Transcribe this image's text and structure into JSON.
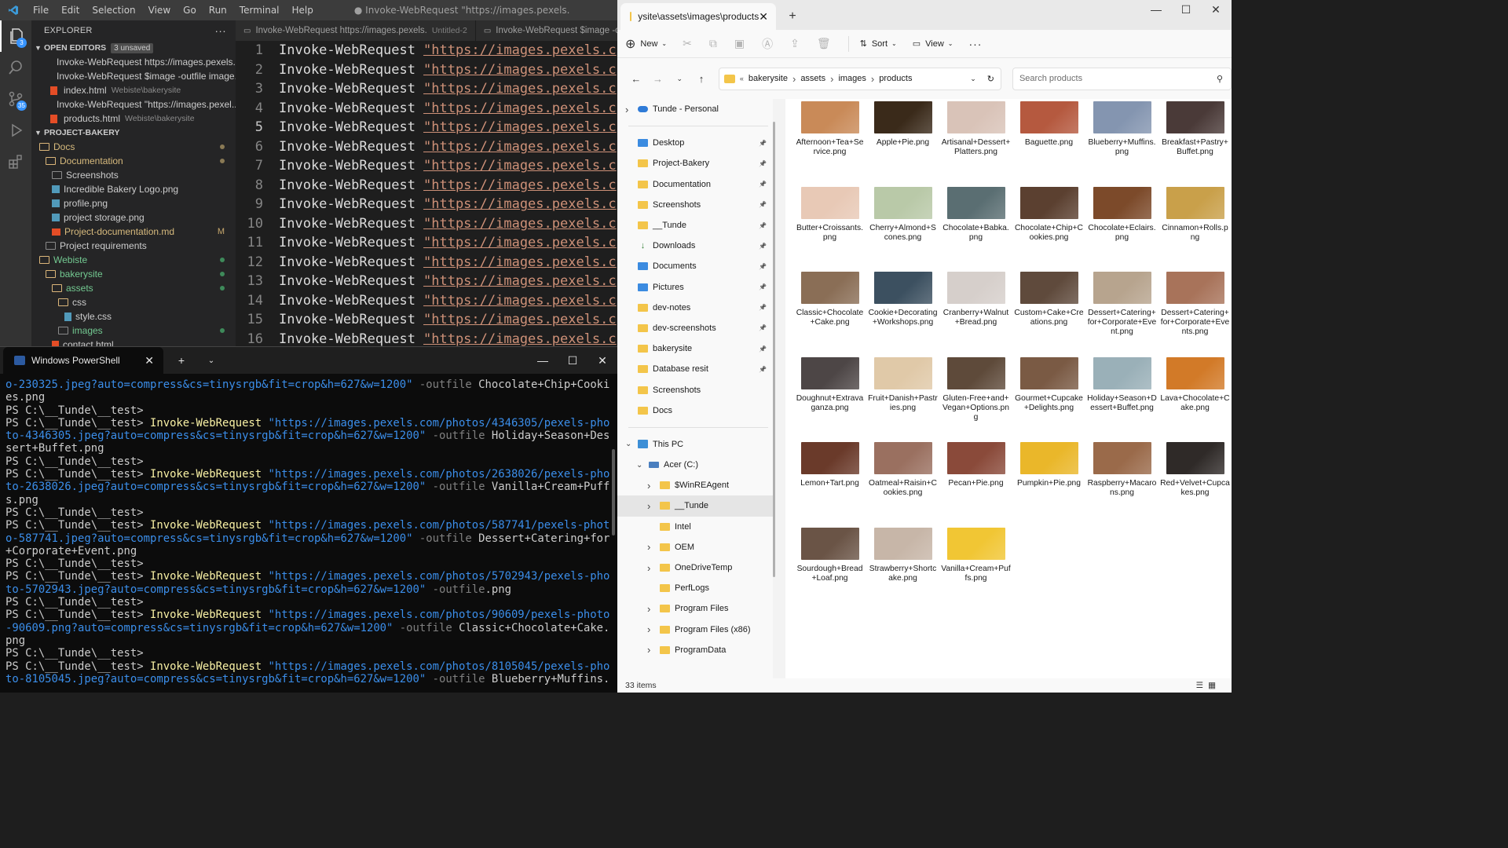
{
  "vscode": {
    "menus": [
      "File",
      "Edit",
      "Selection",
      "View",
      "Go",
      "Run",
      "Terminal",
      "Help"
    ],
    "window_title": "● Invoke-WebRequest \"https://images.pexels.",
    "activity_badges": {
      "explorer": "3",
      "scm": "35"
    },
    "explorer": {
      "title": "EXPLORER",
      "open_editors_label": "OPEN EDITORS",
      "unsaved_label": "3 unsaved",
      "open_editors": [
        {
          "name": "Invoke-WebRequest https://images.pexels...",
          "hint": "",
          "icon": "dot"
        },
        {
          "name": "Invoke-WebRequest $image -outfile image...",
          "hint": "",
          "icon": "dot"
        },
        {
          "name": "index.html",
          "hint": "Webiste\\bakerysite",
          "icon": "html"
        },
        {
          "name": "Invoke-WebRequest \"https://images.pexel...",
          "hint": "",
          "icon": "dot"
        },
        {
          "name": "products.html",
          "hint": "Webiste\\bakerysite",
          "icon": "html"
        }
      ],
      "project_label": "PROJECT-BAKERY",
      "tree": [
        {
          "name": "Docs",
          "type": "folder-open",
          "indent": 0,
          "color": "orange",
          "status": "dot"
        },
        {
          "name": "Documentation",
          "type": "folder-open",
          "indent": 1,
          "color": "orange",
          "status": "dot"
        },
        {
          "name": "Screenshots",
          "type": "folder",
          "indent": 2,
          "color": "default",
          "status": ""
        },
        {
          "name": "Incredible Bakery Logo.png",
          "type": "image",
          "indent": 2,
          "color": "default",
          "status": ""
        },
        {
          "name": "profile.png",
          "type": "image",
          "indent": 2,
          "color": "default",
          "status": ""
        },
        {
          "name": "project storage.png",
          "type": "image",
          "indent": 2,
          "color": "default",
          "status": ""
        },
        {
          "name": "Project-documentation.md",
          "type": "md",
          "indent": 2,
          "color": "orange",
          "status": "M"
        },
        {
          "name": "Project requirements",
          "type": "folder",
          "indent": 1,
          "color": "default",
          "status": ""
        },
        {
          "name": "Webiste",
          "type": "folder-open",
          "indent": 0,
          "color": "green",
          "status": "gdot"
        },
        {
          "name": "bakerysite",
          "type": "folder-open",
          "indent": 1,
          "color": "green",
          "status": "gdot"
        },
        {
          "name": "assets",
          "type": "folder-open",
          "indent": 2,
          "color": "green",
          "status": "gdot"
        },
        {
          "name": "css",
          "type": "folder-open",
          "indent": 3,
          "color": "default",
          "status": ""
        },
        {
          "name": "style.css",
          "type": "css",
          "indent": 4,
          "color": "default",
          "status": ""
        },
        {
          "name": "images",
          "type": "folder",
          "indent": 3,
          "color": "green",
          "status": "gdot"
        },
        {
          "name": "contact.html",
          "type": "html",
          "indent": 2,
          "color": "default",
          "status": ""
        }
      ]
    },
    "tabs": [
      {
        "label": "Invoke-WebRequest https://images.pexels.",
        "sub": "Untitled-2"
      },
      {
        "label": "Invoke-WebRequest $image -outfi",
        "sub": ""
      }
    ],
    "editor": {
      "command": "Invoke-WebRequest",
      "string": "\"https://images.pexels.c",
      "current_line": 5,
      "line_numbers": [
        "1",
        "2",
        "3",
        "4",
        "5",
        "6",
        "7",
        "8",
        "9",
        "10",
        "11",
        "12",
        "13",
        "14",
        "15",
        "16"
      ]
    }
  },
  "powershell": {
    "tab_title": "Windows PowerShell",
    "lines": [
      [
        [
          "o-230325.jpeg?auto=compress&cs=tinysrgb&fit=crop&h=627&w=1200\"",
          "str"
        ],
        [
          " -outfile",
          "par"
        ],
        [
          " Chocolate+Chip+Cooki",
          "txt"
        ]
      ],
      [
        [
          "es.png",
          "txt"
        ]
      ],
      [
        [
          "PS C:\\__Tunde\\__test>",
          "txt"
        ]
      ],
      [
        [
          "PS C:\\__Tunde\\__test> ",
          "txt"
        ],
        [
          "Invoke-WebRequest",
          "cmd"
        ],
        [
          " \"https://images.pexels.com/photos/4346305/pexels-pho",
          "str"
        ]
      ],
      [
        [
          "to-4346305.jpeg?auto=compress&cs=tinysrgb&fit=crop&h=627&w=1200\"",
          "str"
        ],
        [
          " -outfile",
          "par"
        ],
        [
          " Holiday+Season+Des",
          "txt"
        ]
      ],
      [
        [
          "sert+Buffet.png",
          "txt"
        ]
      ],
      [
        [
          "PS C:\\__Tunde\\__test>",
          "txt"
        ]
      ],
      [
        [
          "PS C:\\__Tunde\\__test> ",
          "txt"
        ],
        [
          "Invoke-WebRequest",
          "cmd"
        ],
        [
          " \"https://images.pexels.com/photos/2638026/pexels-pho",
          "str"
        ]
      ],
      [
        [
          "to-2638026.jpeg?auto=compress&cs=tinysrgb&fit=crop&h=627&w=1200\"",
          "str"
        ],
        [
          " -outfile",
          "par"
        ],
        [
          " Vanilla+Cream+Puff",
          "txt"
        ]
      ],
      [
        [
          "s.png",
          "txt"
        ]
      ],
      [
        [
          "PS C:\\__Tunde\\__test>",
          "txt"
        ]
      ],
      [
        [
          "PS C:\\__Tunde\\__test> ",
          "txt"
        ],
        [
          "Invoke-WebRequest",
          "cmd"
        ],
        [
          " \"https://images.pexels.com/photos/587741/pexels-phot",
          "str"
        ]
      ],
      [
        [
          "o-587741.jpeg?auto=compress&cs=tinysrgb&fit=crop&h=627&w=1200\"",
          "str"
        ],
        [
          " -outfile",
          "par"
        ],
        [
          " Dessert+Catering+for",
          "txt"
        ]
      ],
      [
        [
          "+Corporate+Event.png",
          "txt"
        ]
      ],
      [
        [
          "PS C:\\__Tunde\\__test>",
          "txt"
        ]
      ],
      [
        [
          "PS C:\\__Tunde\\__test> ",
          "txt"
        ],
        [
          "Invoke-WebRequest",
          "cmd"
        ],
        [
          " \"https://images.pexels.com/photos/5702943/pexels-pho",
          "str"
        ]
      ],
      [
        [
          "to-5702943.jpeg?auto=compress&cs=tinysrgb&fit=crop&h=627&w=1200\"",
          "str"
        ],
        [
          " -outfile",
          "par"
        ],
        [
          ".png",
          "txt"
        ]
      ],
      [
        [
          "PS C:\\__Tunde\\__test>",
          "txt"
        ]
      ],
      [
        [
          "PS C:\\__Tunde\\__test> ",
          "txt"
        ],
        [
          "Invoke-WebRequest",
          "cmd"
        ],
        [
          " \"https://images.pexels.com/photos/90609/pexels-photo",
          "str"
        ]
      ],
      [
        [
          "-90609.png?auto=compress&cs=tinysrgb&fit=crop&h=627&w=1200\"",
          "str"
        ],
        [
          " -outfile",
          "par"
        ],
        [
          " Classic+Chocolate+Cake.",
          "txt"
        ]
      ],
      [
        [
          "png",
          "txt"
        ]
      ],
      [
        [
          "PS C:\\__Tunde\\__test>",
          "txt"
        ]
      ],
      [
        [
          "PS C:\\__Tunde\\__test> ",
          "txt"
        ],
        [
          "Invoke-WebRequest",
          "cmd"
        ],
        [
          " \"https://images.pexels.com/photos/8105045/pexels-pho",
          "str"
        ]
      ],
      [
        [
          "to-8105045.jpeg?auto=compress&cs=tinysrgb&fit=crop&h=627&w=1200\"",
          "str"
        ],
        [
          " -outfile",
          "par"
        ],
        [
          " Blueberry+Muffins.",
          "txt"
        ]
      ]
    ]
  },
  "explorer": {
    "tab_title": "ysite\\assets\\images\\products",
    "commands": {
      "new": "New",
      "sort": "Sort",
      "view": "View"
    },
    "breadcrumb": [
      "bakerysite",
      "assets",
      "images",
      "products"
    ],
    "search_placeholder": "Search products",
    "nav_items": [
      {
        "label": "Tunde - Personal",
        "icon": "cloud",
        "indent": 0,
        "chev": "right",
        "pin": false,
        "group": 1
      },
      {
        "label": "Desktop",
        "icon": "blue",
        "indent": 0,
        "chev": "",
        "pin": true,
        "group": 2
      },
      {
        "label": "Project-Bakery",
        "icon": "folder",
        "indent": 0,
        "chev": "",
        "pin": true,
        "group": 2
      },
      {
        "label": "Documentation",
        "icon": "folder",
        "indent": 0,
        "chev": "",
        "pin": true,
        "group": 2
      },
      {
        "label": "Screenshots",
        "icon": "folder",
        "indent": 0,
        "chev": "",
        "pin": true,
        "group": 2
      },
      {
        "label": "__Tunde",
        "icon": "folder",
        "indent": 0,
        "chev": "",
        "pin": true,
        "group": 2
      },
      {
        "label": "Downloads",
        "icon": "download",
        "indent": 0,
        "chev": "",
        "pin": true,
        "group": 2
      },
      {
        "label": "Documents",
        "icon": "doc",
        "indent": 0,
        "chev": "",
        "pin": true,
        "group": 2
      },
      {
        "label": "Pictures",
        "icon": "blue",
        "indent": 0,
        "chev": "",
        "pin": true,
        "group": 2
      },
      {
        "label": "dev-notes",
        "icon": "folder",
        "indent": 0,
        "chev": "",
        "pin": true,
        "group": 2
      },
      {
        "label": "dev-screenshots",
        "icon": "folder",
        "indent": 0,
        "chev": "",
        "pin": true,
        "group": 2
      },
      {
        "label": "bakerysite",
        "icon": "folder",
        "indent": 0,
        "chev": "",
        "pin": true,
        "group": 2
      },
      {
        "label": "Database resit",
        "icon": "folder",
        "indent": 0,
        "chev": "",
        "pin": true,
        "group": 2
      },
      {
        "label": "Screenshots",
        "icon": "folder",
        "indent": 0,
        "chev": "",
        "pin": false,
        "group": 2
      },
      {
        "label": "Docs",
        "icon": "folder",
        "indent": 0,
        "chev": "",
        "pin": false,
        "group": 2
      },
      {
        "label": "This PC",
        "icon": "pc",
        "indent": 0,
        "chev": "down",
        "pin": false,
        "group": 3
      },
      {
        "label": "Acer (C:)",
        "icon": "drive",
        "indent": 1,
        "chev": "down",
        "pin": false,
        "group": 3
      },
      {
        "label": "$WinREAgent",
        "icon": "folder",
        "indent": 2,
        "chev": "right",
        "pin": false,
        "group": 3
      },
      {
        "label": "__Tunde",
        "icon": "folder",
        "indent": 2,
        "chev": "right",
        "pin": false,
        "group": 3,
        "selected": true
      },
      {
        "label": "Intel",
        "icon": "folder",
        "indent": 2,
        "chev": "",
        "pin": false,
        "group": 3
      },
      {
        "label": "OEM",
        "icon": "folder",
        "indent": 2,
        "chev": "right",
        "pin": false,
        "group": 3
      },
      {
        "label": "OneDriveTemp",
        "icon": "folder",
        "indent": 2,
        "chev": "right",
        "pin": false,
        "group": 3
      },
      {
        "label": "PerfLogs",
        "icon": "folder",
        "indent": 2,
        "chev": "",
        "pin": false,
        "group": 3
      },
      {
        "label": "Program Files",
        "icon": "folder",
        "indent": 2,
        "chev": "right",
        "pin": false,
        "group": 3
      },
      {
        "label": "Program Files (x86)",
        "icon": "folder",
        "indent": 2,
        "chev": "right",
        "pin": false,
        "group": 3
      },
      {
        "label": "ProgramData",
        "icon": "folder",
        "indent": 2,
        "chev": "right",
        "pin": false,
        "group": 3
      }
    ],
    "files": [
      {
        "name": "Afternoon+Tea+Service.png",
        "color": "#c98a58"
      },
      {
        "name": "Apple+Pie.png",
        "color": "#3a2a1a"
      },
      {
        "name": "Artisanal+Dessert+Platters.png",
        "color": "#d9c3b8"
      },
      {
        "name": "Baguette.png",
        "color": "#b5593f"
      },
      {
        "name": "Blueberry+Muffins.png",
        "color": "#8495b0"
      },
      {
        "name": "Breakfast+Pastry+Buffet.png",
        "color": "#4a3a38"
      },
      {
        "name": "Butter+Croissants.png",
        "color": "#e8c9b6"
      },
      {
        "name": "Cherry+Almond+Scones.png",
        "color": "#b9c9a8"
      },
      {
        "name": "Chocolate+Babka.png",
        "color": "#5a6e72"
      },
      {
        "name": "Chocolate+Chip+Cookies.png",
        "color": "#5b4030"
      },
      {
        "name": "Chocolate+Eclairs.png",
        "color": "#7c4a2a"
      },
      {
        "name": "Cinnamon+Rolls.png",
        "color": "#c9a04a"
      },
      {
        "name": "Classic+Chocolate+Cake.png",
        "color": "#8a6e56"
      },
      {
        "name": "Cookie+Decorating+Workshops.png",
        "color": "#3c5060"
      },
      {
        "name": "Cranberry+Walnut+Bread.png",
        "color": "#d6cfcb"
      },
      {
        "name": "Custom+Cake+Creations.png",
        "color": "#5f4a3c"
      },
      {
        "name": "Dessert+Catering+for+Corporate+Event.png",
        "color": "#b7a48e"
      },
      {
        "name": "Dessert+Catering+for+Corporate+Events.png",
        "color": "#a8735a"
      },
      {
        "name": "Doughnut+Extravaganza.png",
        "color": "#4d4646"
      },
      {
        "name": "Fruit+Danish+Pastries.png",
        "color": "#e0c9a8"
      },
      {
        "name": "Gluten-Free+and+Vegan+Options.png",
        "color": "#5e4a3a"
      },
      {
        "name": "Gourmet+Cupcake+Delights.png",
        "color": "#7a5a44"
      },
      {
        "name": "Holiday+Season+Dessert+Buffet.png",
        "color": "#9ab0b8"
      },
      {
        "name": "Lava+Chocolate+Cake.png",
        "color": "#d27a28"
      },
      {
        "name": "Lemon+Tart.png",
        "color": "#6a3a2a"
      },
      {
        "name": "Oatmeal+Raisin+Cookies.png",
        "color": "#9a7060"
      },
      {
        "name": "Pecan+Pie.png",
        "color": "#8a4a3a"
      },
      {
        "name": "Pumpkin+Pie.png",
        "color": "#eab72a"
      },
      {
        "name": "Raspberry+Macarons.png",
        "color": "#9a6a4a"
      },
      {
        "name": "Red+Velvet+Cupcakes.png",
        "color": "#2f2a28"
      },
      {
        "name": "Sourdough+Bread+Loaf.png",
        "color": "#6a5446"
      },
      {
        "name": "Strawberry+Shortcake.png",
        "color": "#c7b6a8"
      },
      {
        "name": "Vanilla+Cream+Puffs.png",
        "color": "#f1c634"
      }
    ],
    "status": "33 items"
  }
}
